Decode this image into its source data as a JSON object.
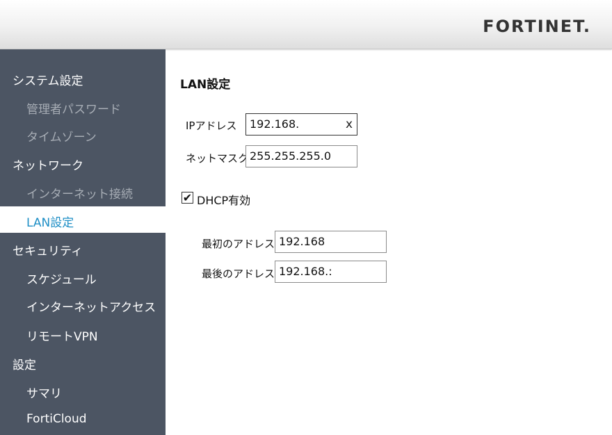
{
  "header": {
    "logo_text": "FORTINET."
  },
  "sidebar": {
    "groups": [
      {
        "label": "システム設定",
        "items": [
          "管理者パスワード",
          "タイムゾーン"
        ]
      },
      {
        "label": "ネットワーク",
        "items": [
          "インターネット接続",
          "LAN設定"
        ]
      },
      {
        "label": "セキュリティ",
        "items": [
          "スケジュール",
          "インターネットアクセス",
          "リモートVPN"
        ]
      },
      {
        "label": "設定",
        "items": [
          "サマリ",
          "FortiCloud"
        ]
      }
    ]
  },
  "main": {
    "title": "LAN設定",
    "ip_label": "IPアドレス",
    "ip_value": "192.168.",
    "clear_icon": "x",
    "netmask_label": "ネットマスク",
    "netmask_value": "255.255.255.0",
    "dhcp_label": "DHCP有効",
    "dhcp_checked": true,
    "first_label": "最初のアドレス",
    "first_value": "192.168",
    "last_label": "最後のアドレス",
    "last_value": "192.168.:"
  },
  "colors": {
    "sidebar_bg": "#4c5563",
    "active_text": "#1f8fc6",
    "logo_red": "#da291c"
  }
}
